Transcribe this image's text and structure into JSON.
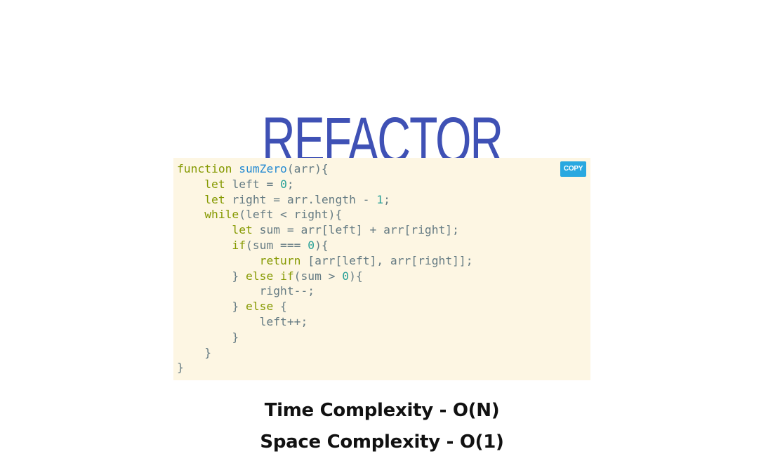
{
  "title": "REFACTOR",
  "code": {
    "copy_label": "COPY",
    "lines": [
      [
        {
          "t": "function",
          "c": "kw"
        },
        {
          "t": " "
        },
        {
          "t": "sumZero",
          "c": "fn"
        },
        {
          "t": "(arr){"
        }
      ],
      [
        {
          "t": "    "
        },
        {
          "t": "let",
          "c": "kw"
        },
        {
          "t": " left = "
        },
        {
          "t": "0",
          "c": "num"
        },
        {
          "t": ";"
        }
      ],
      [
        {
          "t": "    "
        },
        {
          "t": "let",
          "c": "kw"
        },
        {
          "t": " right = arr.length - "
        },
        {
          "t": "1",
          "c": "num"
        },
        {
          "t": ";"
        }
      ],
      [
        {
          "t": "    "
        },
        {
          "t": "while",
          "c": "kw"
        },
        {
          "t": "(left < right){"
        }
      ],
      [
        {
          "t": "        "
        },
        {
          "t": "let",
          "c": "kw"
        },
        {
          "t": " sum = arr[left] + arr[right];"
        }
      ],
      [
        {
          "t": "        "
        },
        {
          "t": "if",
          "c": "kw"
        },
        {
          "t": "(sum === "
        },
        {
          "t": "0",
          "c": "num"
        },
        {
          "t": "){"
        }
      ],
      [
        {
          "t": "            "
        },
        {
          "t": "return",
          "c": "kw"
        },
        {
          "t": " [arr[left], arr[right]];"
        }
      ],
      [
        {
          "t": "        } "
        },
        {
          "t": "else",
          "c": "kw"
        },
        {
          "t": " "
        },
        {
          "t": "if",
          "c": "kw"
        },
        {
          "t": "(sum > "
        },
        {
          "t": "0",
          "c": "num"
        },
        {
          "t": "){"
        }
      ],
      [
        {
          "t": "            right--;"
        }
      ],
      [
        {
          "t": "        } "
        },
        {
          "t": "else",
          "c": "kw"
        },
        {
          "t": " {"
        }
      ],
      [
        {
          "t": "            left++;"
        }
      ],
      [
        {
          "t": "        }"
        }
      ],
      [
        {
          "t": "    }"
        }
      ],
      [
        {
          "t": "}"
        }
      ]
    ]
  },
  "complexity": {
    "time": "Time Complexity - O(N)",
    "space": "Space Complexity - O(1)"
  },
  "colors": {
    "title": "#3f51b5",
    "code_background": "#fdf6e3",
    "copy_button": "#29a8e0",
    "keyword": "#859900",
    "function_name": "#268bd2",
    "number": "#2aa198",
    "plain_code": "#657b83"
  }
}
